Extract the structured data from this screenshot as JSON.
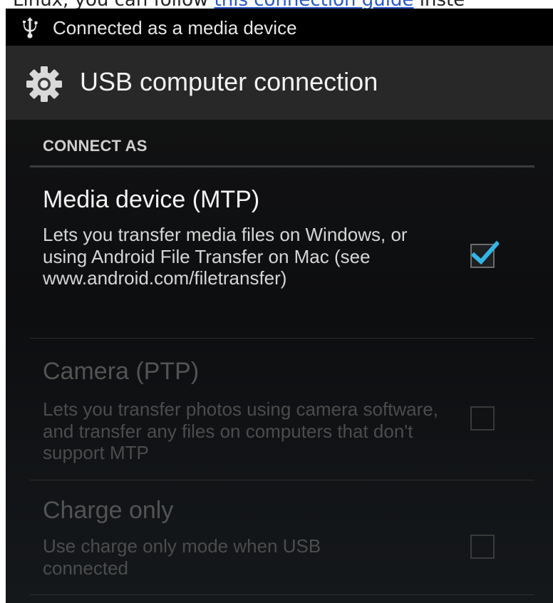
{
  "page_top_text": {
    "before_link": "Linux, you can follow ",
    "link": "this connection guide",
    "after_link": " inste"
  },
  "status_bar": {
    "icon": "usb-icon",
    "text": "Connected as a media device"
  },
  "action_bar": {
    "icon": "gear-icon",
    "title": "USB computer connection"
  },
  "section": {
    "header": "CONNECT AS"
  },
  "options": [
    {
      "title": "Media device (MTP)",
      "description": "Lets you transfer media files on Windows, or using Android File Transfer on Mac (see www.android.com/filetransfer)",
      "checked": true,
      "enabled": true
    },
    {
      "title": "Camera (PTP)",
      "description": "Lets you transfer photos using camera software, and transfer any files on computers that don't support MTP",
      "checked": false,
      "enabled": false
    },
    {
      "title": "Charge only",
      "description": "Use charge only mode when USB connected",
      "checked": false,
      "enabled": false
    }
  ],
  "colors": {
    "accent_checkmark": "#33b5e5",
    "status_bar_bg": "#000000",
    "action_bar_bg": "#282828"
  }
}
